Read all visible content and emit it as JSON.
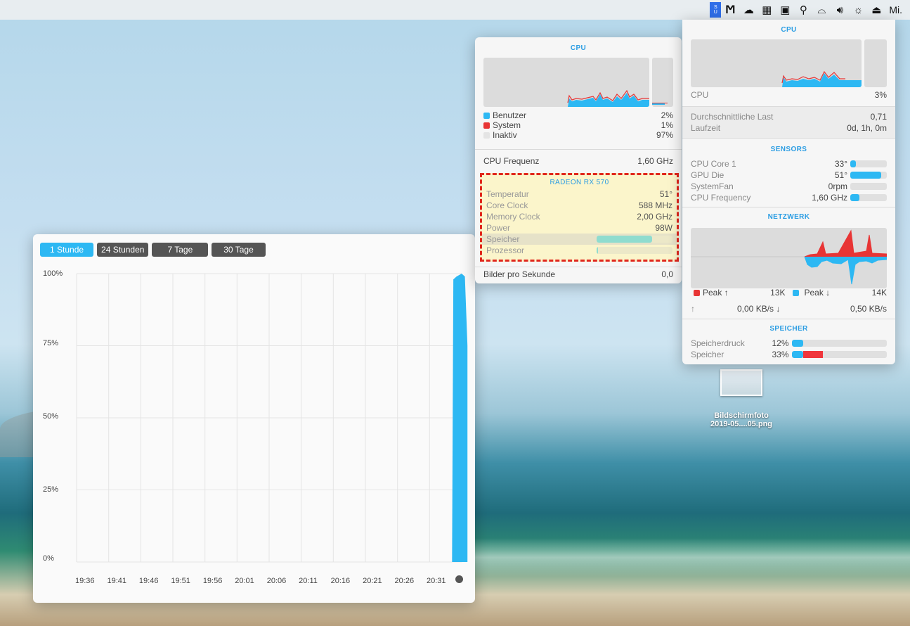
{
  "menubar": {
    "stats_icon": "istat-menus-icon",
    "stats_letters": [
      "S",
      "U"
    ],
    "icons": [
      "memory-monitor-icon",
      "cloud-icon",
      "dock-icon",
      "gpu-icon",
      "search-icon",
      "airplay-icon",
      "volume-icon",
      "brightness-icon",
      "eject-icon"
    ],
    "clock": "Mi."
  },
  "cpu_popover": {
    "title": "CPU",
    "benutzer_label": "Benutzer",
    "benutzer_value": "2%",
    "system_label": "System",
    "system_value": "1%",
    "inaktiv_label": "Inaktiv",
    "inaktiv_value": "97%",
    "freq_label": "CPU Frequenz",
    "freq_value": "1,60 GHz",
    "gpu": {
      "title": "RADEON RX 570",
      "rows": [
        {
          "label": "Temperatur",
          "value": "51°"
        },
        {
          "label": "Core Clock",
          "value": "588 MHz"
        },
        {
          "label": "Memory Clock",
          "value": "2,00 GHz"
        },
        {
          "label": "Power",
          "value": "98W"
        }
      ],
      "speicher_label": "Speicher",
      "speicher_fill": 0.73,
      "prozessor_label": "Prozessor",
      "prozessor_fill": 0.01
    },
    "fps_label": "Bilder pro Sekunde",
    "fps_value": "0,0"
  },
  "menu_dropdown": {
    "cpu_title": "CPU",
    "cpu_label": "CPU",
    "cpu_value": "3%",
    "last_label": "Durchschnittliche Last",
    "last_value": "0,71",
    "laufzeit_label": "Laufzeit",
    "laufzeit_value": "0d, 1h, 0m",
    "sensors_title": "SENSORS",
    "sensors": [
      {
        "label": "CPU Core 1",
        "value": "33°",
        "fill": 0.15
      },
      {
        "label": "GPU Die",
        "value": "51°",
        "fill": 0.85
      },
      {
        "label": "SystemFan",
        "value": "0rpm",
        "fill": 0.0
      },
      {
        "label": "CPU Frequency",
        "value": "1,60 GHz",
        "fill": 0.25
      }
    ],
    "net_title": "NETZWERK",
    "peak_up_label": "Peak ↑",
    "peak_up_value": "13K",
    "peak_down_label": "Peak ↓",
    "peak_down_value": "14K",
    "up_arrow": "↑",
    "up_value": "0,00 KB/s ↓",
    "down_value": "0,50 KB/s",
    "mem_title": "SPEICHER",
    "druck_label": "Speicherdruck",
    "druck_value": "12%",
    "druck_fill": 0.12,
    "speicher_label": "Speicher",
    "speicher_value": "33%",
    "speicher_fill_blue": 0.12,
    "speicher_fill_red": 0.21
  },
  "history": {
    "tabs": [
      "1 Stunde",
      "24 Stunden",
      "7 Tage",
      "30 Tage"
    ],
    "active_tab": 0
  },
  "chart_data": {
    "type": "area",
    "x": [
      "19:36",
      "19:41",
      "19:46",
      "19:51",
      "19:56",
      "20:01",
      "20:06",
      "20:11",
      "20:16",
      "20:21",
      "20:26",
      "20:31"
    ],
    "ytick_labels": [
      "0%",
      "25%",
      "50%",
      "75%",
      "100%"
    ],
    "ylim": [
      0,
      100
    ],
    "grid": true,
    "color": "#2db8f3",
    "series": [
      {
        "values_minutes_after_1936": [
          58.5,
          58.7,
          59.2,
          60.0,
          60.5,
          60.9
        ],
        "values": [
          0,
          98,
          99,
          100,
          99,
          75
        ]
      }
    ]
  },
  "desktop_file": {
    "name_line1": "Bildschirmfoto",
    "name_line2": "2019-05....05.png"
  }
}
